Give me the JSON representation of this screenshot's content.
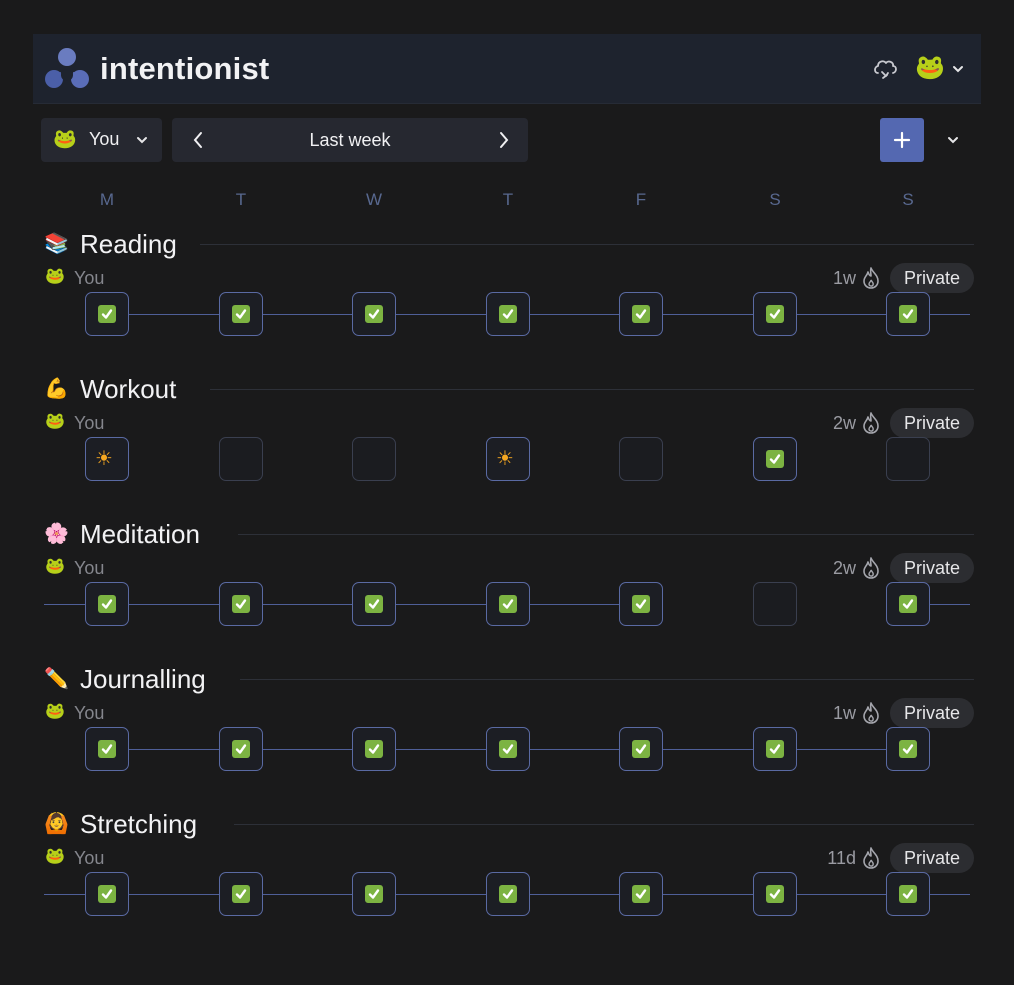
{
  "header": {
    "brand": "intentionist",
    "logo_icon": "three-circles-logo-icon",
    "sync_icon": "cloud-sync-icon",
    "avatar_icon": "frog-icon"
  },
  "toolbar": {
    "user_label": "You",
    "user_icon": "frog-icon",
    "week_label": "Last week",
    "add_icon": "plus-icon",
    "more_icon": "chevron-down-icon"
  },
  "days": [
    "M",
    "T",
    "W",
    "T",
    "F",
    "S",
    "S"
  ],
  "colors": {
    "accent": "#5468b1",
    "check": "#7cb342",
    "day_header": "#58688f",
    "background": "#1a1a1b"
  },
  "habits": [
    {
      "icon": "📚",
      "name": "Reading",
      "owner_icon": "🐸",
      "owner": "You",
      "streak": "1w",
      "visibility": "Private",
      "line_from_left": false,
      "line_to_right": true,
      "days": [
        "check",
        "check",
        "check",
        "check",
        "check",
        "check",
        "check"
      ]
    },
    {
      "icon": "💪",
      "name": "Workout",
      "owner_icon": "🐸",
      "owner": "You",
      "streak": "2w",
      "visibility": "Private",
      "line_from_left": false,
      "line_to_right": false,
      "days": [
        "sun",
        "empty",
        "empty",
        "sun",
        "empty",
        "check",
        "empty"
      ]
    },
    {
      "icon": "🌸",
      "name": "Meditation",
      "owner_icon": "🐸",
      "owner": "You",
      "streak": "2w",
      "visibility": "Private",
      "line_from_left": true,
      "line_to_right": true,
      "days": [
        "check",
        "check",
        "check",
        "check",
        "check",
        "empty",
        "check"
      ]
    },
    {
      "icon": "✏️",
      "name": "Journalling",
      "owner_icon": "🐸",
      "owner": "You",
      "streak": "1w",
      "visibility": "Private",
      "line_from_left": false,
      "line_to_right": false,
      "days": [
        "check",
        "check",
        "check",
        "check",
        "check",
        "check",
        "check"
      ]
    },
    {
      "icon": "🙆",
      "name": "Stretching",
      "owner_icon": "🐸",
      "owner": "You",
      "streak": "11d",
      "visibility": "Private",
      "line_from_left": true,
      "line_to_right": true,
      "days": [
        "check",
        "check",
        "check",
        "check",
        "check",
        "check",
        "check"
      ]
    }
  ]
}
